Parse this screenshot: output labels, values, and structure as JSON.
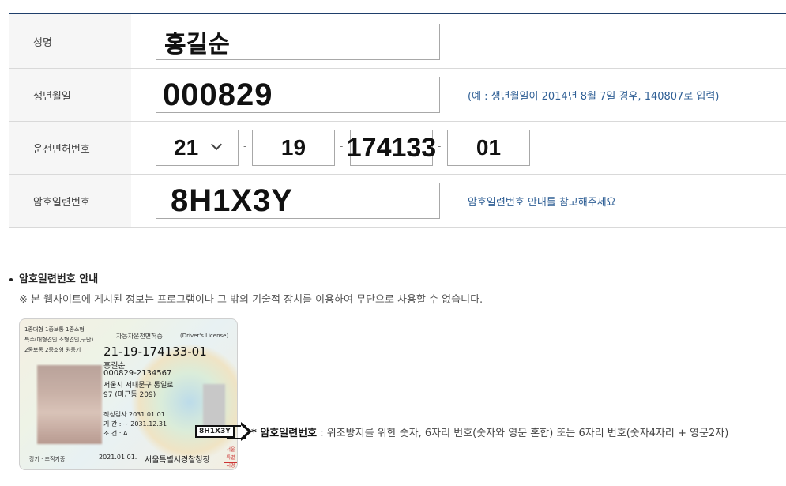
{
  "form": {
    "name": {
      "label": "성명",
      "value": "홍길순"
    },
    "birth": {
      "label": "생년월일",
      "value": "000829",
      "hint": "(예 : 생년월일이 2014년 8월 7일 경우, 140807로 입력)"
    },
    "license": {
      "label": "운전면허번호",
      "region": "21",
      "part2": "19",
      "part3": "174133",
      "part4": "01",
      "separator": "-"
    },
    "serial": {
      "label": "암호일련번호",
      "value": "8H1X3Y",
      "hint": "암호일련번호 안내를 참고해주세요"
    }
  },
  "guide": {
    "title": "암호일련번호 안내",
    "note": "※ 본 웹사이트에 게시된 정보는 프로그램이나 그 밖의 기술적 장치를 이용하여 무단으로 사용할 수 없습니다.",
    "explain_label": "* 암호일련번호",
    "explain_text": " : 위조방지를 위한 숫자, 6자리 번호(숫자와 영문 혼합) 또는 6자리 번호(숫자4자리 + 영문2자)"
  },
  "card": {
    "classes1": "1종대형 1종보통 1종소형",
    "classes2": "특수(대형견인,소형견인,구난)",
    "classes3": "2종보통 2종소형 원동기",
    "title": "자동차운전면허증",
    "title_en": "(Driver's License)",
    "number": "21-19-174133-01",
    "name": "홍길순",
    "rrn": "000829-2134567",
    "address1": "서울시 서대문구 통일로",
    "address2": "97 (미근동 209)",
    "renewal": "적성검사   2031.01.01",
    "period": "기    간 :  ~ 2031.12.31",
    "condition": "조    건 : A",
    "serial": "8H1X3Y",
    "footer_left": "장기 · 조직기증",
    "issue_date": "2021.01.01.",
    "issuer": "서울특별시경찰청장",
    "stamp": "서울특별시경찰청장"
  }
}
